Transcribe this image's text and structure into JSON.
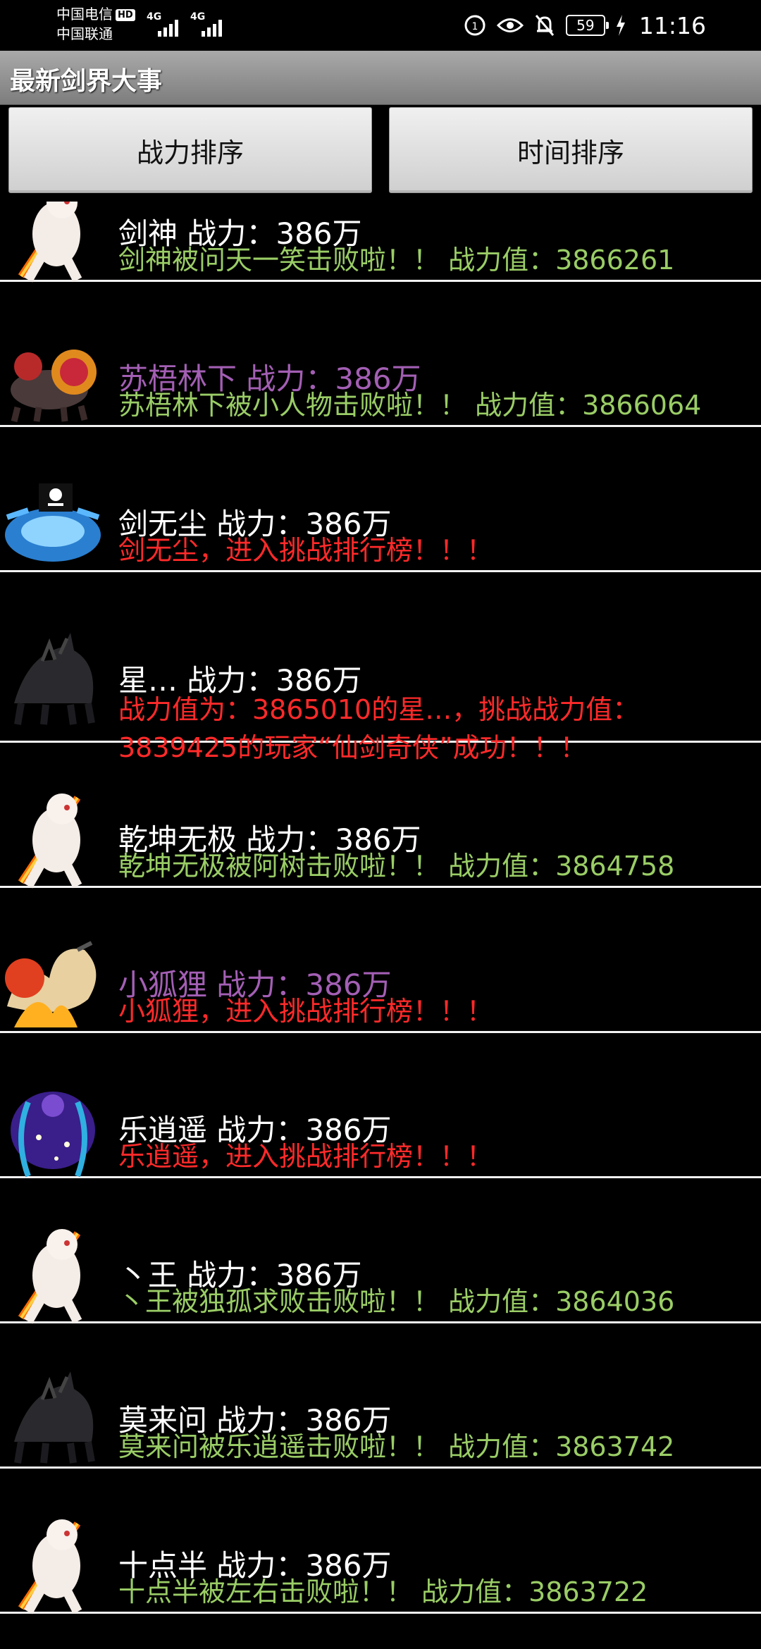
{
  "status_bar": {
    "carrier_1": "中国电信",
    "hd": "HD",
    "carrier_2": "中国联通",
    "network_1": "4G",
    "network_2": "4G",
    "battery": "59",
    "time": "11:16"
  },
  "title": "最新剑界大事",
  "buttons": {
    "power_sort": "战力排序",
    "time_sort": "时间排序"
  },
  "colors": {
    "white": "#ffffff",
    "purple": "#a35fb4",
    "green": "#9acd66",
    "red": "#ff2a2a"
  },
  "items": [
    {
      "title": "剑神 战力：386万",
      "title_color": "white",
      "message": "剑神被问天一笑击败啦！！ 战力值：3866261",
      "message_color": "green",
      "avatar": "white-fire-sword-creature-icon"
    },
    {
      "title": "苏梧林下 战力：386万",
      "title_color": "purple",
      "message": "苏梧林下被小人物击败啦！！ 战力值：3866064",
      "message_color": "green",
      "avatar": "lion-beast-icon"
    },
    {
      "title": "剑无尘 战力：386万",
      "title_color": "white",
      "message": "剑无尘，进入挑战排行榜！！！",
      "message_color": "red",
      "avatar": "blue-water-dragon-icon"
    },
    {
      "title": "星… 战力：386万",
      "title_color": "white",
      "message": "战力值为：3865010的星…，挑战战力值：",
      "message_2": "3839425的玩家“仙剑奇侠”成功！！！",
      "message_color": "red",
      "avatar": "dark-shadow-beast-icon"
    },
    {
      "title": "乾坤无极 战力：386万",
      "title_color": "white",
      "message": "乾坤无极被阿树击败啦！！ 战力值：3864758",
      "message_color": "green",
      "avatar": "white-fire-sword-creature-icon"
    },
    {
      "title": "小狐狸 战力：386万",
      "title_color": "purple",
      "message": "小狐狸，进入挑战排行榜！！！",
      "message_color": "red",
      "avatar": "fire-fox-icon"
    },
    {
      "title": "乐逍遥 战力：386万",
      "title_color": "white",
      "message": "乐逍遥，进入挑战排行榜！！！",
      "message_color": "red",
      "avatar": "starry-spirit-icon"
    },
    {
      "title": "丶王 战力：386万",
      "title_color": "white",
      "message": "丶王被独孤求败击败啦！！ 战力值：3864036",
      "message_color": "green",
      "avatar": "white-fire-sword-creature-icon"
    },
    {
      "title": "莫来问 战力：386万",
      "title_color": "white",
      "message": "莫来问被乐逍遥击败啦！！ 战力值：3863742",
      "message_color": "green",
      "avatar": "dark-shadow-beast-icon"
    },
    {
      "title": "十点半 战力：386万",
      "title_color": "white",
      "message": "十点半被左右击败啦！！ 战力值：3863722",
      "message_color": "green",
      "avatar": "white-fire-sword-creature-icon"
    }
  ]
}
